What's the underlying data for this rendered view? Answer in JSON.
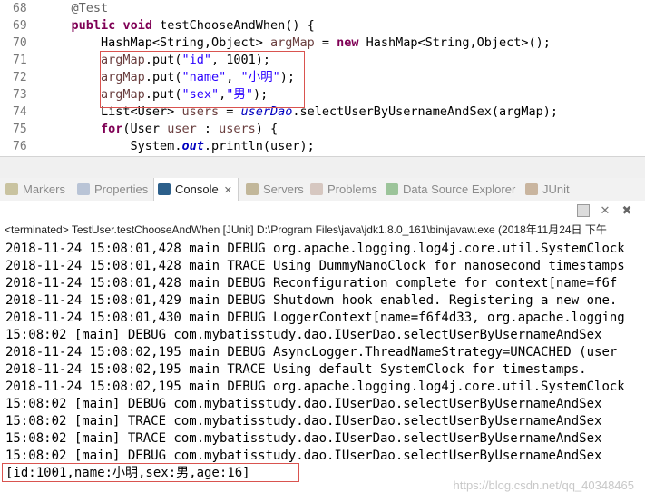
{
  "editor": {
    "line_numbers": [
      "68",
      "69",
      "70",
      "71",
      "72",
      "73",
      "74",
      "75",
      "76"
    ],
    "lines": [
      {
        "tokens": [
          {
            "t": "@Test",
            "c": "an"
          }
        ],
        "indent": "    "
      },
      {
        "tokens": [
          {
            "t": "public",
            "c": "kw"
          },
          {
            "t": " "
          },
          {
            "t": "void",
            "c": "kw"
          },
          {
            "t": " testChooseAndWhen() {"
          }
        ],
        "indent": "    "
      },
      {
        "tokens": [
          {
            "t": "HashMap<String,Object> "
          },
          {
            "t": "argMap",
            "c": "var"
          },
          {
            "t": " = "
          },
          {
            "t": "new",
            "c": "kw"
          },
          {
            "t": " HashMap<String,Object>();"
          }
        ],
        "indent": "        "
      },
      {
        "tokens": [
          {
            "t": "argMap",
            "c": "var"
          },
          {
            "t": ".put("
          },
          {
            "t": "\"id\"",
            "c": "str"
          },
          {
            "t": ", 1001);"
          }
        ],
        "indent": "        "
      },
      {
        "tokens": [
          {
            "t": "argMap",
            "c": "var"
          },
          {
            "t": ".put("
          },
          {
            "t": "\"name\"",
            "c": "str"
          },
          {
            "t": ", "
          },
          {
            "t": "\"小明\"",
            "c": "str"
          },
          {
            "t": ");"
          }
        ],
        "indent": "        "
      },
      {
        "tokens": [
          {
            "t": "argMap",
            "c": "var"
          },
          {
            "t": ".put("
          },
          {
            "t": "\"sex\"",
            "c": "str"
          },
          {
            "t": ","
          },
          {
            "t": "\"男\"",
            "c": "str"
          },
          {
            "t": ");"
          }
        ],
        "indent": "        "
      },
      {
        "tokens": [
          {
            "t": "List<User> "
          },
          {
            "t": "users",
            "c": "var"
          },
          {
            "t": " = "
          },
          {
            "t": "userDao",
            "c": "fld ital"
          },
          {
            "t": ".selectUserByUsernameAndSex(argMap);"
          }
        ],
        "indent": "        "
      },
      {
        "tokens": [
          {
            "t": "for",
            "c": "kw"
          },
          {
            "t": "(User "
          },
          {
            "t": "user",
            "c": "var"
          },
          {
            "t": " : "
          },
          {
            "t": "users",
            "c": "var"
          },
          {
            "t": ") {"
          }
        ],
        "indent": "        "
      },
      {
        "tokens": [
          {
            "t": "System."
          },
          {
            "t": "out",
            "c": "fld ital kw"
          },
          {
            "t": ".println(user);"
          }
        ],
        "indent": "            "
      }
    ]
  },
  "tabs": [
    {
      "label": "Markers",
      "icon": "markers-icon"
    },
    {
      "label": "Properties",
      "icon": "properties-icon"
    },
    {
      "label": "Console",
      "icon": "console-icon",
      "active": true
    },
    {
      "label": "Servers",
      "icon": "servers-icon"
    },
    {
      "label": "Problems",
      "icon": "problems-icon"
    },
    {
      "label": "Data Source Explorer",
      "icon": "data-source-icon"
    },
    {
      "label": "JUnit",
      "icon": "junit-icon"
    }
  ],
  "status_line": "<terminated> TestUser.testChooseAndWhen [JUnit] D:\\Program Files\\java\\jdk1.8.0_161\\bin\\javaw.exe (2018年11月24日 下午",
  "console_lines": [
    "2018-11-24 15:08:01,428 main DEBUG org.apache.logging.log4j.core.util.SystemClock",
    "2018-11-24 15:08:01,428 main TRACE Using DummyNanoClock for nanosecond timestamps",
    "2018-11-24 15:08:01,428 main DEBUG Reconfiguration complete for context[name=f6f",
    "2018-11-24 15:08:01,429 main DEBUG Shutdown hook enabled. Registering a new one.",
    "2018-11-24 15:08:01,430 main DEBUG LoggerContext[name=f6f4d33, org.apache.logging",
    "15:08:02 [main] DEBUG com.mybatisstudy.dao.IUserDao.selectUserByUsernameAndSex",
    "2018-11-24 15:08:02,195 main DEBUG AsyncLogger.ThreadNameStrategy=UNCACHED (user",
    "2018-11-24 15:08:02,195 main TRACE Using default SystemClock for timestamps.",
    "2018-11-24 15:08:02,195 main DEBUG org.apache.logging.log4j.core.util.SystemClock",
    "15:08:02 [main] DEBUG com.mybatisstudy.dao.IUserDao.selectUserByUsernameAndSex",
    "15:08:02 [main] TRACE com.mybatisstudy.dao.IUserDao.selectUserByUsernameAndSex",
    "15:08:02 [main] TRACE com.mybatisstudy.dao.IUserDao.selectUserByUsernameAndSex",
    "15:08:02 [main] DEBUG com.mybatisstudy.dao.IUserDao.selectUserByUsernameAndSex",
    "[id:1001,name:小明,sex:男,age:16]"
  ],
  "watermark": "https://blog.csdn.net/qq_40348465"
}
